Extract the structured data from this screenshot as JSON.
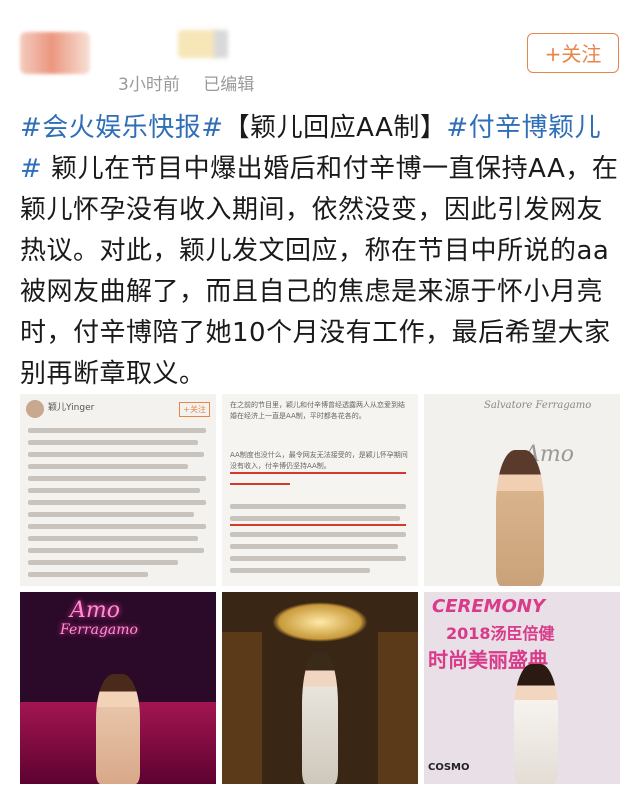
{
  "header": {
    "time": "3小时前",
    "edited": "已编辑",
    "follow_label": "+关注"
  },
  "post": {
    "tag1": "#会火娱乐快报#",
    "bracket": "【颖儿回应AA制】",
    "tag2": "#付辛博颖儿#",
    "body": "颖儿在节目中爆出婚后和付辛博一直保持AA，在颖儿怀孕没有收入期间，依然没变，因此引发网友热议。对此，颖儿发文回应，称在节目中所说的aa被网友曲解了，而且自己的焦虑是来源于怀小月亮时，付辛博陪了她10个月没有工作，最后希望大家别再断章取义。"
  },
  "images": {
    "shot1_name": "颖儿Yinger",
    "shot1_follow": "+关注",
    "shot2_text1": "在之前的节目里，颖儿和付辛博曾经透露两人从恋爱到结婚在经济上一直是AA制，平时都各花各的。",
    "shot2_text2": "AA制度也没什么，最令网友无法接受的，是颖儿怀孕期间没有收入，付辛博仍坚持AA制。",
    "brand_top": "Salvatore Ferragamo",
    "amo": "Amo",
    "ferragamo": "Ferragamo",
    "ceremony": "CEREMONY",
    "year_event": "2018汤臣倍健",
    "event2": "时尚美丽盛典",
    "cosmo": "COSMO"
  },
  "colors": {
    "link": "#2f6fb8",
    "follow": "#e8864a",
    "meta": "#9a9a9a"
  }
}
